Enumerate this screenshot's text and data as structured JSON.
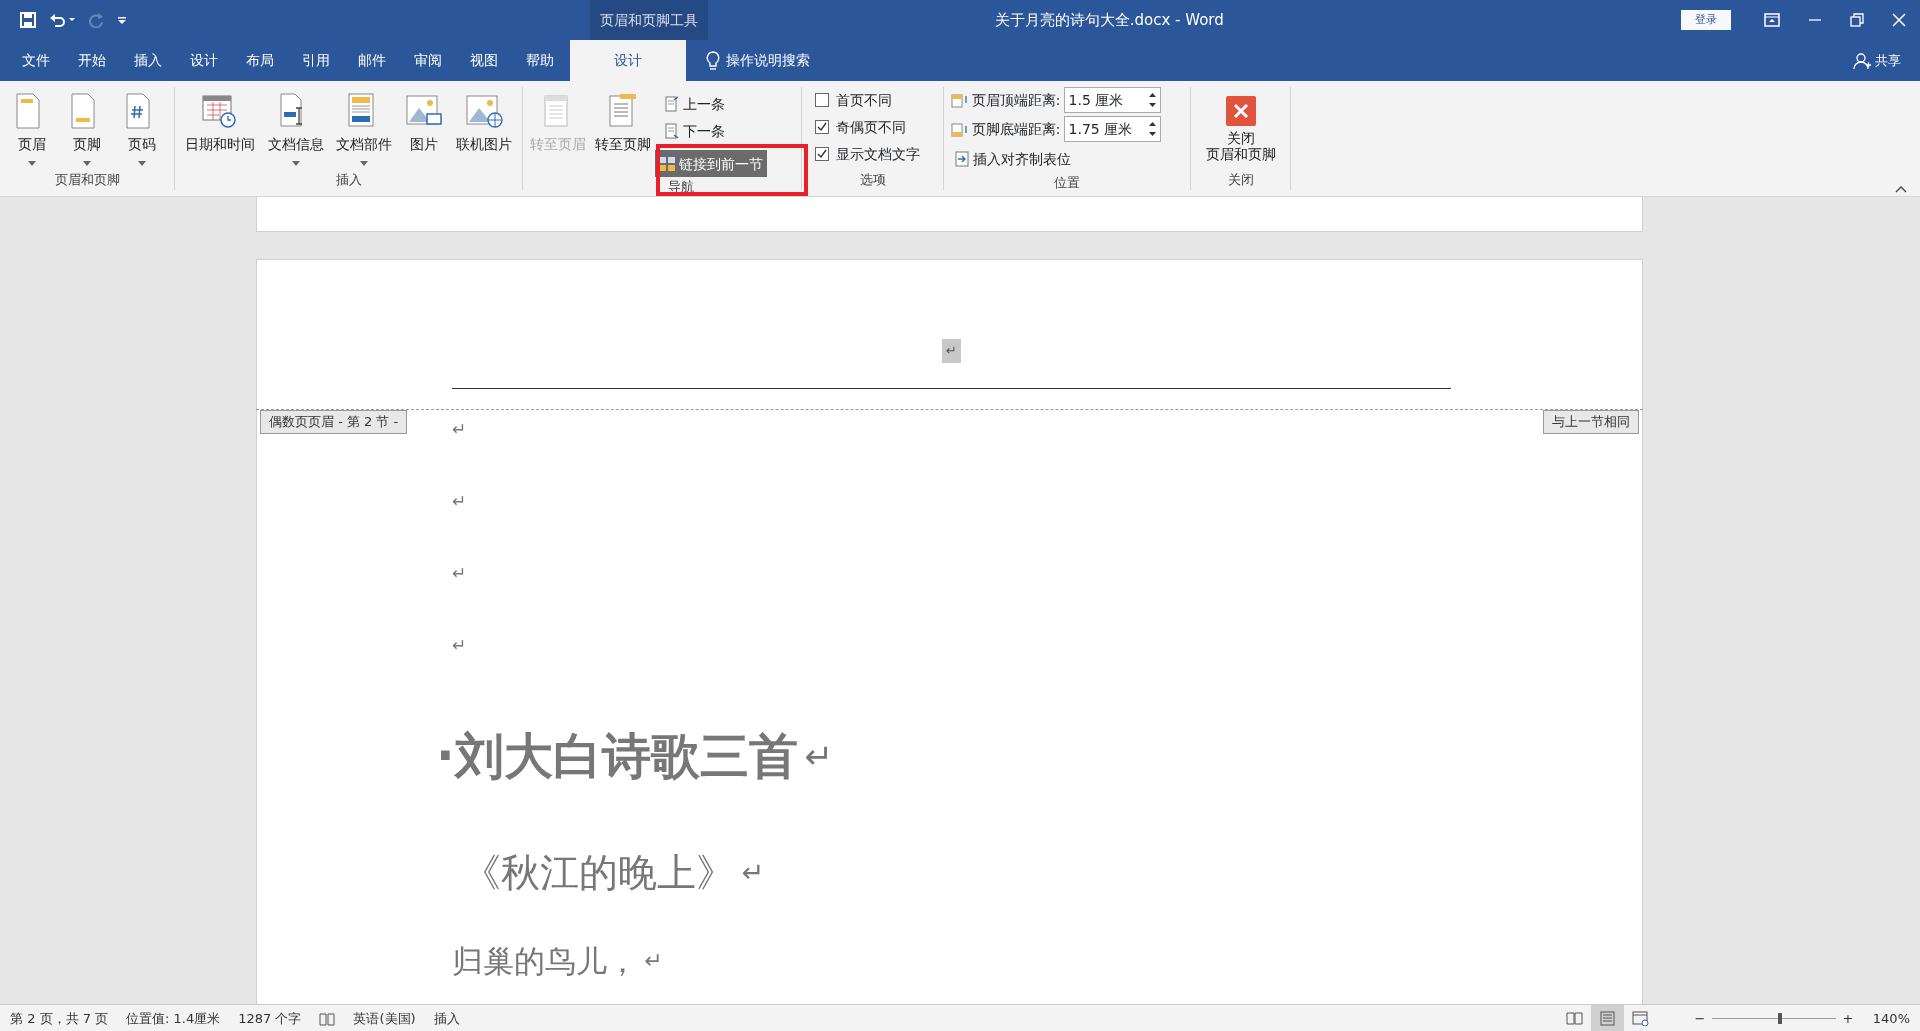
{
  "title_bar": {
    "contextual_tab": "页眉和页脚工具",
    "title": "关于月亮的诗句大全.docx - Word",
    "login": "登录",
    "redo_disabled": true
  },
  "menu": {
    "tabs": [
      {
        "label": "文件",
        "selected": false
      },
      {
        "label": "开始",
        "selected": false
      },
      {
        "label": "插入",
        "selected": false
      },
      {
        "label": "设计",
        "selected": false
      },
      {
        "label": "布局",
        "selected": false
      },
      {
        "label": "引用",
        "selected": false
      },
      {
        "label": "邮件",
        "selected": false
      },
      {
        "label": "审阅",
        "selected": false
      },
      {
        "label": "视图",
        "selected": false
      },
      {
        "label": "帮助",
        "selected": false
      },
      {
        "label": "设计",
        "selected": true
      }
    ],
    "search": "操作说明搜索",
    "share": "共享"
  },
  "ribbon": {
    "groups": [
      {
        "kind": "big",
        "label": "页眉和页脚",
        "buttons": [
          {
            "label": "页眉",
            "dropdown": true,
            "disabled": false
          },
          {
            "label": "页脚",
            "dropdown": true,
            "disabled": false
          },
          {
            "label": "页码",
            "dropdown": true,
            "disabled": false
          }
        ]
      },
      {
        "kind": "big",
        "label": "插入",
        "buttons": [
          {
            "label": "日期和时间",
            "dropdown": false,
            "disabled": false
          },
          {
            "label": "文档信息",
            "dropdown": true,
            "disabled": false
          },
          {
            "label": "文档部件",
            "dropdown": true,
            "disabled": false
          },
          {
            "label": "图片",
            "dropdown": false,
            "disabled": false
          },
          {
            "label": "联机图片",
            "dropdown": false,
            "disabled": false
          }
        ]
      },
      {
        "kind": "nav",
        "label": "导航",
        "buttons": [
          {
            "label": "转至页眉",
            "dropdown": false,
            "disabled": true
          },
          {
            "label": "转至页脚",
            "dropdown": false,
            "disabled": false
          }
        ],
        "small": [
          {
            "label": "上一条",
            "selected": false
          },
          {
            "label": "下一条",
            "selected": false
          },
          {
            "label": "链接到前一节",
            "selected": true
          }
        ]
      },
      {
        "kind": "options",
        "label": "选项",
        "checks": [
          {
            "label": "首页不同",
            "checked": false
          },
          {
            "label": "奇偶页不同",
            "checked": true
          },
          {
            "label": "显示文档文字",
            "checked": true
          }
        ]
      },
      {
        "kind": "position",
        "label": "位置",
        "fields": [
          {
            "label": "页眉顶端距离:",
            "value": "1.5 厘米"
          },
          {
            "label": "页脚底端距离:",
            "value": "1.75 厘米"
          }
        ],
        "action": "插入对齐制表位"
      },
      {
        "kind": "close",
        "label": "关闭",
        "button": [
          "关闭",
          "页眉和页脚"
        ]
      }
    ]
  },
  "document": {
    "header_mark": "↵",
    "header_tag": "偶数页页眉 - 第 2 节 -",
    "link_tag": "与上一节相同",
    "paragraphs": [
      {
        "kind": "empty",
        "mark": "↵"
      },
      {
        "kind": "empty",
        "mark": "↵"
      },
      {
        "kind": "empty",
        "mark": "↵"
      },
      {
        "kind": "empty",
        "mark": "↵"
      },
      {
        "kind": "heading",
        "text": "·刘大白诗歌三首",
        "mark": "↵"
      },
      {
        "kind": "subtitle",
        "text": "《秋江的晚上》",
        "mark": "↵"
      },
      {
        "kind": "line",
        "text": "归巢的鸟儿，",
        "mark": "↵"
      }
    ]
  },
  "status_bar": {
    "items": [
      "第 2 页，共 7 页",
      "位置值: 1.4厘米",
      "1287 个字"
    ],
    "language": "英语(美国)",
    "mode": "插入",
    "views": [
      {
        "kind": "read",
        "selected": false
      },
      {
        "kind": "print",
        "selected": true
      },
      {
        "kind": "web",
        "selected": false
      }
    ],
    "zoom_out": "−",
    "zoom_in": "+",
    "zoom_slider": {
      "level": 0.55
    },
    "zoom": "140%"
  }
}
